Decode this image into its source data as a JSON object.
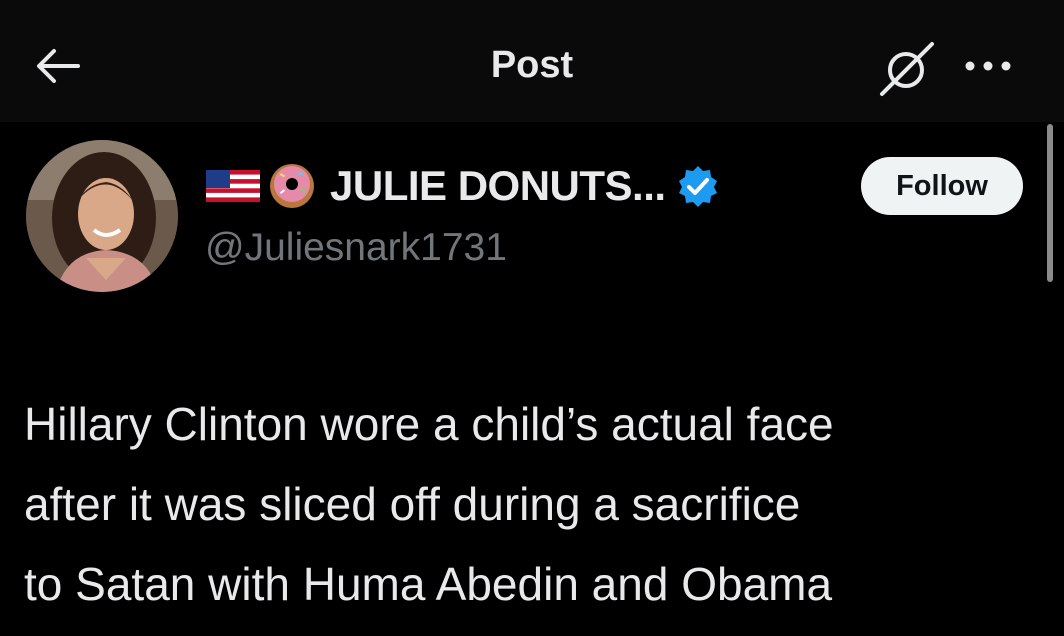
{
  "header": {
    "title": "Post",
    "back_icon": "arrow-left-icon",
    "grok_icon": "grok-slash-icon",
    "more_icon": "more-horizontal-icon"
  },
  "author": {
    "display_name": "JULIE DONUTS...",
    "handle": "@Juliesnark1731",
    "emojis": [
      "us-flag-icon",
      "donut-icon"
    ],
    "verified_icon": "verified-badge-icon",
    "verified_color": "#1d9bf0",
    "follow_label": "Follow"
  },
  "post": {
    "lines": [
      "Hillary Clinton wore a child’s actual face",
      "after it was sliced off during a sacrifice",
      "to Satan with Huma Abedin and Obama"
    ]
  },
  "colors": {
    "background": "#000000",
    "text": "#e7e9ea",
    "secondary_text": "#71767b",
    "follow_bg": "#eff3f4"
  }
}
